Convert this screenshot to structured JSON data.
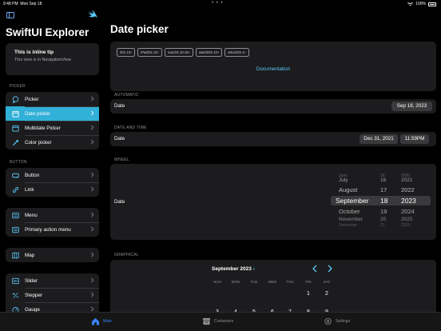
{
  "status": {
    "time": "9:48 PM",
    "date": "Mon Sep 18",
    "battery": "100%"
  },
  "sidebar": {
    "title": "SwiftUI Explorer",
    "tip": {
      "title": "This is inline tip",
      "subtitle": "This view is in NavigationView"
    },
    "sections": [
      {
        "label": "PICKER",
        "items": [
          {
            "label": "Picker",
            "icon": "bubble-icon"
          },
          {
            "label": "Date picker",
            "icon": "calendar-icon",
            "selected": true
          },
          {
            "label": "Multidate Picker",
            "icon": "calendar-icon"
          },
          {
            "label": "Color picker",
            "icon": "eyedropper-icon"
          }
        ]
      },
      {
        "label": "BUTTON",
        "items": [
          {
            "label": "Button",
            "icon": "button-icon"
          },
          {
            "label": "Link",
            "icon": "link-icon"
          }
        ]
      },
      {
        "label": "",
        "items": [
          {
            "label": "Menu",
            "icon": "menu-icon"
          },
          {
            "label": "Primary action menu",
            "icon": "menu-icon"
          }
        ]
      },
      {
        "label": "",
        "items": [
          {
            "label": "Map",
            "icon": "map-icon"
          }
        ]
      },
      {
        "label": "",
        "items": [
          {
            "label": "Slider",
            "icon": "slider-icon"
          },
          {
            "label": "Stepper",
            "icon": "stepper-icon"
          },
          {
            "label": "Gauge",
            "icon": "gauge-icon"
          }
        ]
      }
    ]
  },
  "main": {
    "title": "Date picker",
    "badges": [
      "iOS 13+",
      "iPadOS 13+",
      "macOS 10.15+",
      "watchOS 10+",
      "visionOS 1+"
    ],
    "documentation": "Documentation",
    "automatic": {
      "section": "AUTOMATIC",
      "label": "Date",
      "value": "Sep 18, 2023"
    },
    "date_time": {
      "section": "DATE AND TIME",
      "label": "Date",
      "date": "Dec 31, 2021",
      "time": "11:59PM"
    },
    "wheel": {
      "section": "WHEEL",
      "label": "Date",
      "months": [
        "June",
        "July",
        "August",
        "September",
        "October",
        "November",
        "December"
      ],
      "days": [
        "16",
        "16",
        "17",
        "18",
        "19",
        "20",
        "21"
      ],
      "years": [
        "2020",
        "2021",
        "2022",
        "2023",
        "2024",
        "2025",
        "2026"
      ]
    },
    "graphical": {
      "section": "GRAPHICAL",
      "month": "September 2023",
      "weekdays": [
        "SUN",
        "MON",
        "TUE",
        "WED",
        "THU",
        "FRI",
        "SAT"
      ],
      "week1": [
        "1",
        "2"
      ],
      "week2": [
        "3",
        "4",
        "5",
        "6",
        "7",
        "8",
        "9"
      ]
    }
  },
  "tabbar": {
    "main": "Main",
    "containers": "Containers",
    "settings": "Settings"
  },
  "colors": {
    "accent": "#31b0d8",
    "link": "#5ac8fa",
    "selection_tab": "#3b82f6"
  }
}
